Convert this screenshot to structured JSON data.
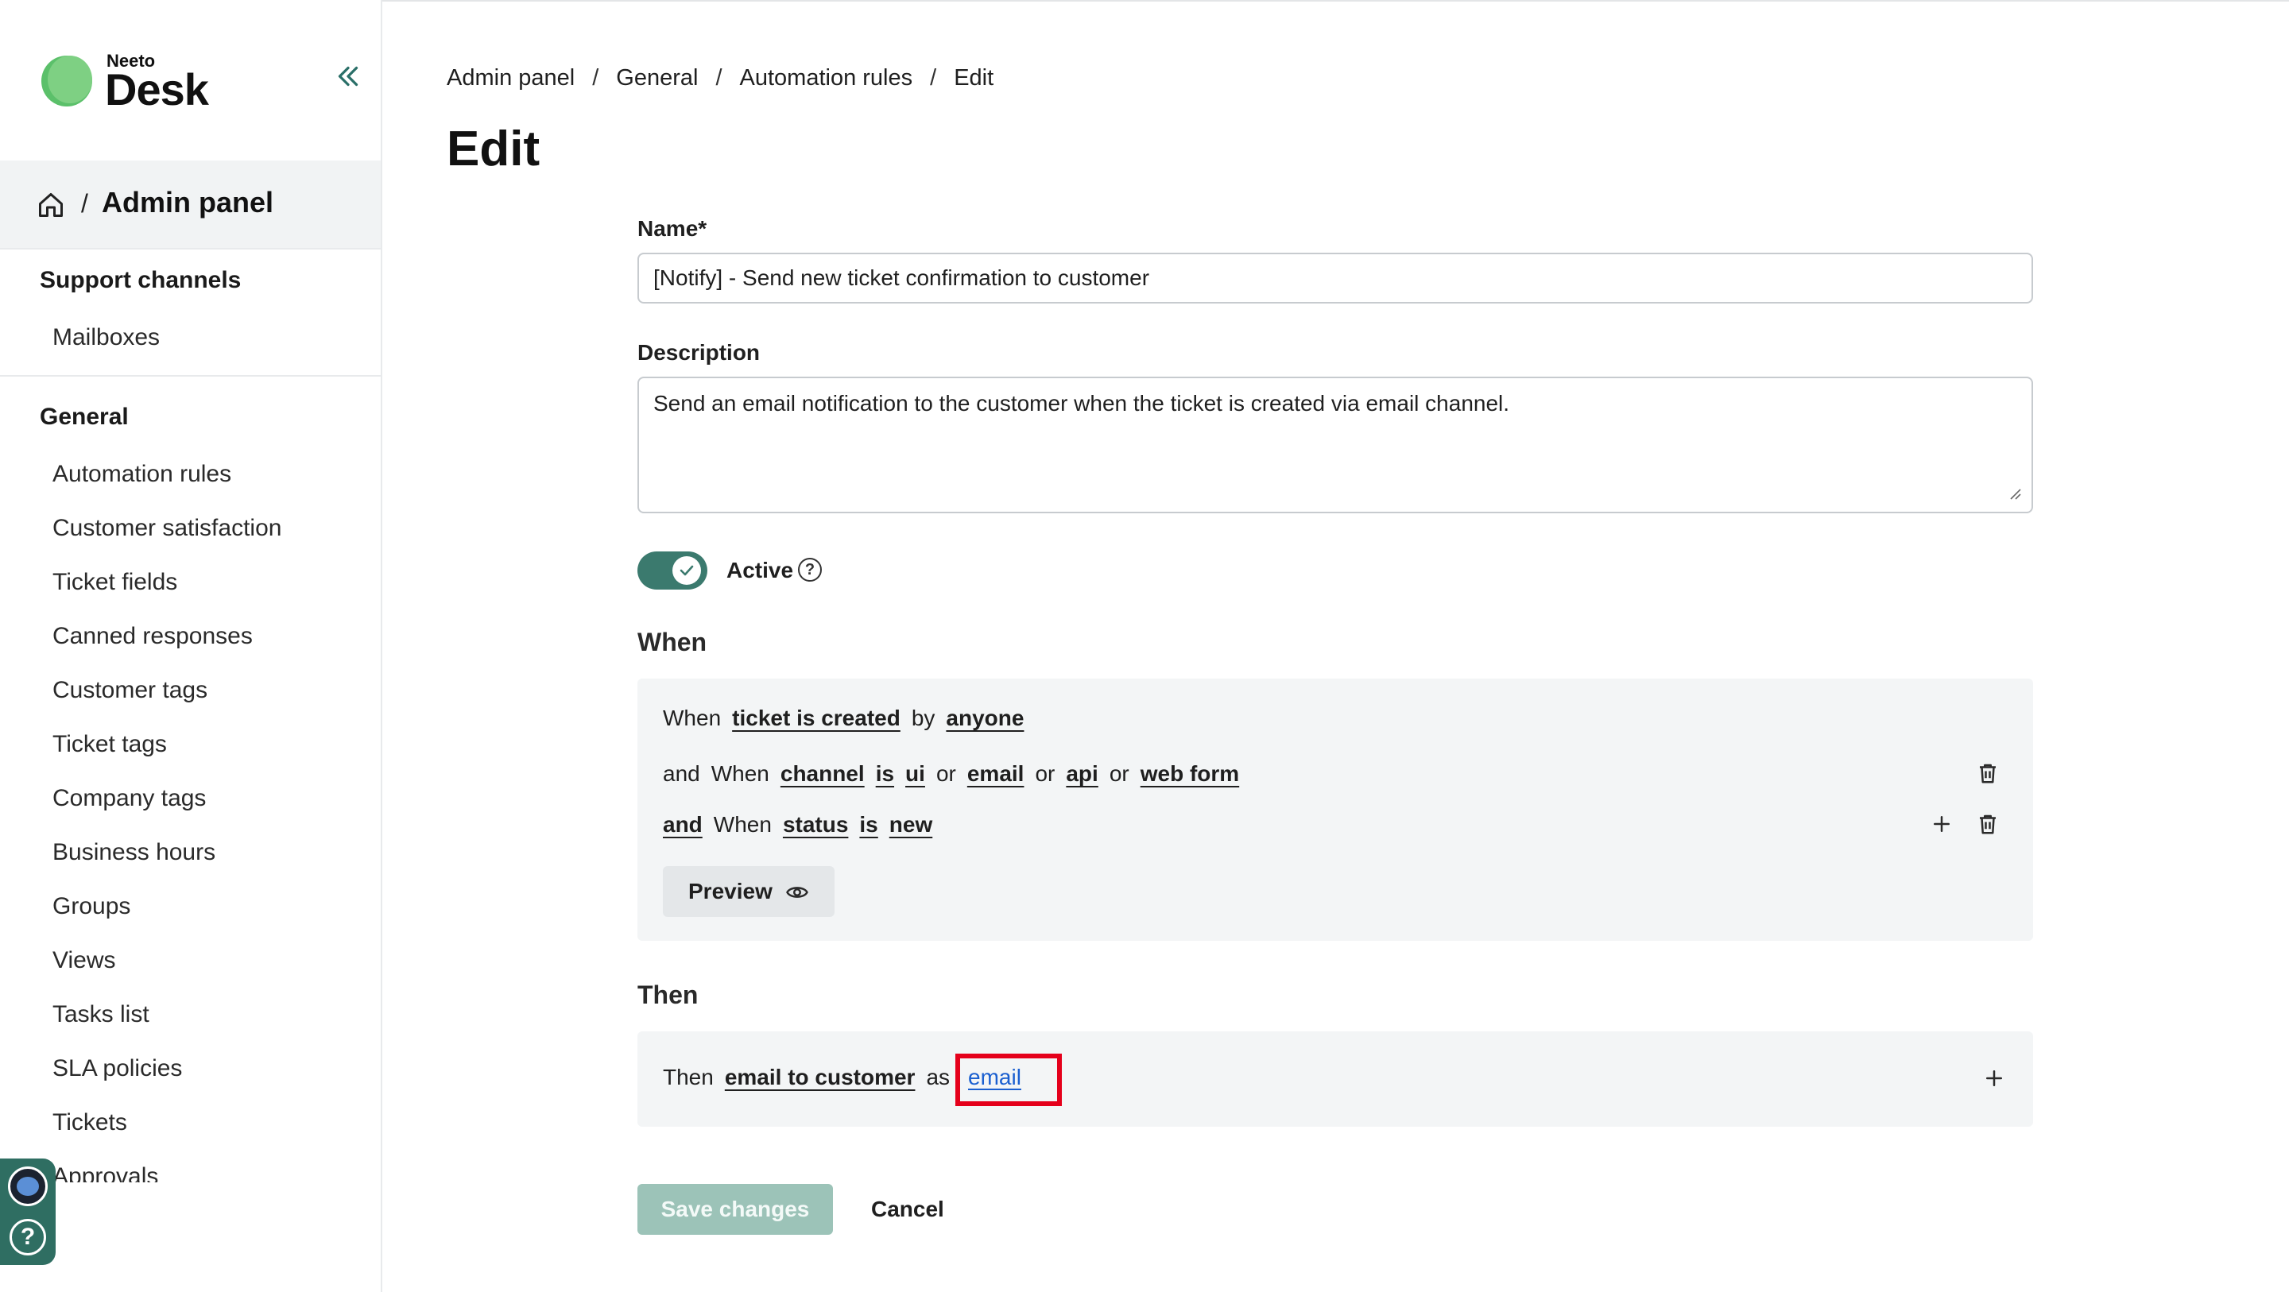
{
  "brand": {
    "top": "Neeto",
    "name": "Desk"
  },
  "sidebar": {
    "admin_title": "Admin panel",
    "admin_sep": "/",
    "support_channels": {
      "heading": "Support channels",
      "items": [
        "Mailboxes"
      ]
    },
    "general": {
      "heading": "General",
      "items": [
        "Automation rules",
        "Customer satisfaction",
        "Ticket fields",
        "Canned responses",
        "Customer tags",
        "Ticket tags",
        "Company tags",
        "Business hours",
        "Groups",
        "Views",
        "Tasks list",
        "SLA policies",
        "Tickets",
        "Approvals"
      ]
    },
    "help_symbol": "?"
  },
  "breadcrumb": [
    "Admin panel",
    "General",
    "Automation rules",
    "Edit"
  ],
  "breadcrumb_sep": "/",
  "page": {
    "title": "Edit"
  },
  "form": {
    "name_label": "Name*",
    "name_value": "[Notify] - Send new ticket confirmation to customer",
    "description_label": "Description",
    "description_value": "Send an email notification to the customer when the ticket is created via email channel.",
    "active_label": "Active",
    "active": true,
    "help_symbol": "?"
  },
  "when": {
    "heading": "When",
    "row1": {
      "w": "When",
      "event": "ticket is created",
      "by": "by",
      "actor": "anyone"
    },
    "row2": {
      "and": "and",
      "w": "When",
      "field": "channel",
      "op": "is",
      "v1": "ui",
      "or1": "or",
      "v2": "email",
      "or2": "or",
      "v3": "api",
      "or3": "or",
      "v4": "web form"
    },
    "row3": {
      "and": "and",
      "w": "When",
      "field": "status",
      "op": "is",
      "value": "new"
    },
    "preview_label": "Preview",
    "add_symbol": "+"
  },
  "then": {
    "heading": "Then",
    "t": "Then",
    "action": "email to customer",
    "as": "as",
    "value": "email",
    "add_symbol": "+"
  },
  "actions": {
    "save_label": "Save changes",
    "cancel_label": "Cancel"
  },
  "colors": {
    "accent": "#3b7a6e",
    "save_disabled": "#9cc3b8",
    "highlight": "#e5001b",
    "link": "#1a5fd0"
  }
}
